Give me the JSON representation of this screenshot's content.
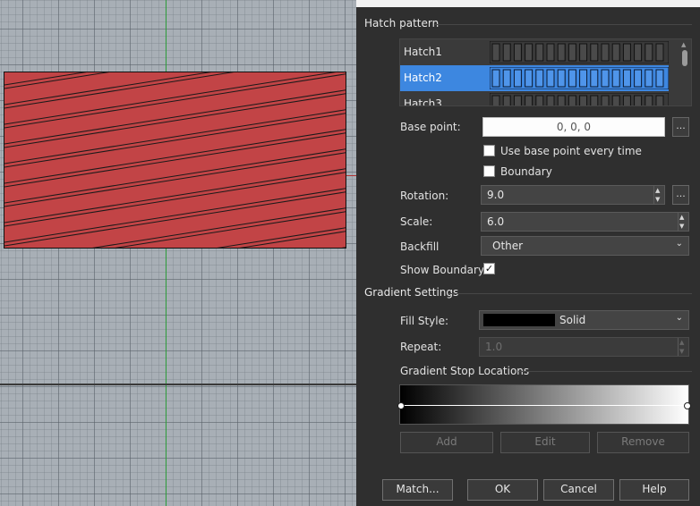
{
  "viewport": {
    "hatch_fill_color": "#c24446",
    "hatch_line_color": "#1a1a1a"
  },
  "panel": {
    "hatch_section": {
      "title": "Hatch pattern",
      "patterns": [
        {
          "name": "Hatch1",
          "selected": false
        },
        {
          "name": "Hatch2",
          "selected": true
        },
        {
          "name": "Hatch3",
          "selected": false
        }
      ],
      "base_point_label": "Base point:",
      "base_point_value": "0, 0, 0",
      "ellipsis": "...",
      "use_base_point_label": "Use base point every time",
      "use_base_point_checked": false,
      "boundary_label": "Boundary",
      "boundary_checked": false,
      "rotation_label": "Rotation:",
      "rotation_value": "9.0",
      "scale_label": "Scale:",
      "scale_value": "6.0",
      "backfill_label": "Backfill",
      "backfill_value": "Other",
      "show_boundary_label": "Show Boundary",
      "show_boundary_checked": true,
      "check_glyph": "✓"
    },
    "gradient_section": {
      "title": "Gradient Settings",
      "fill_style_label": "Fill Style:",
      "fill_style_value": "Solid",
      "fill_swatch_color": "#000000",
      "repeat_label": "Repeat:",
      "repeat_value": "1.0",
      "stop_locations_title": "Gradient Stop Locations",
      "add_label": "Add",
      "edit_label": "Edit",
      "remove_label": "Remove"
    },
    "footer": {
      "match_label": "Match...",
      "ok_label": "OK",
      "cancel_label": "Cancel",
      "help_label": "Help"
    },
    "accent_color": "#3d87e0"
  }
}
